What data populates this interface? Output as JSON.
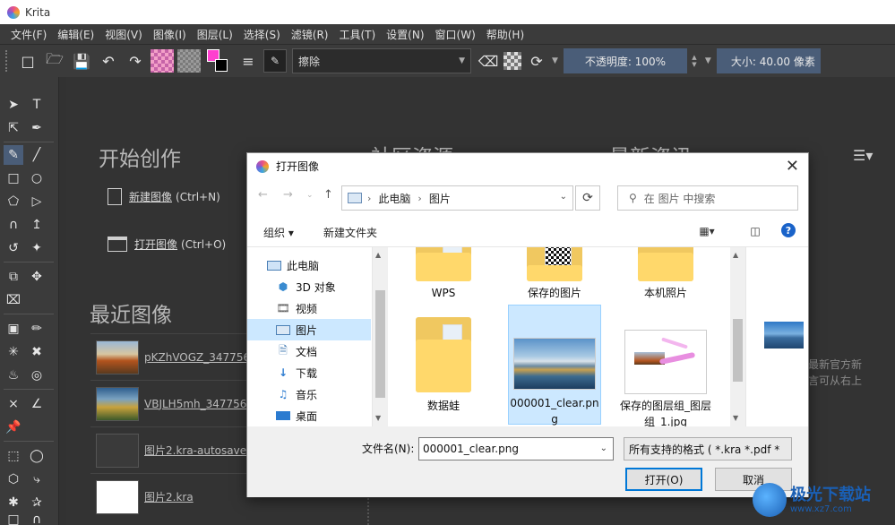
{
  "window": {
    "title": "Krita"
  },
  "menu": [
    "文件(F)",
    "编辑(E)",
    "视图(V)",
    "图像(I)",
    "图层(L)",
    "选择(S)",
    "滤镜(R)",
    "工具(T)",
    "设置(N)",
    "窗口(W)",
    "帮助(H)"
  ],
  "toolbar": {
    "blend_mode": "擦除",
    "opacity": "不透明度: 100%",
    "size": "大小: 40.00 像素",
    "colors": {
      "foreground": "#ff3fcf",
      "background": "#000000",
      "accent": "#4a5d78"
    }
  },
  "welcome": {
    "start_title": "开始创作",
    "new_image": "新建图像",
    "new_image_shortcut": "(Ctrl+N)",
    "open_image": "打开图像",
    "open_image_shortcut": "(Ctrl+O)",
    "recent_title": "最近图像",
    "community_title": "社区资源",
    "news_title": "最新资讯",
    "recent_files": [
      {
        "name": "pKZhVOGZ_347756..."
      },
      {
        "name": "VBJLH5mh_3477564"
      },
      {
        "name": "图片2.kra-autosave..."
      },
      {
        "name": "图片2.kra"
      }
    ],
    "news_text_1": "最新官方新",
    "news_text_2": "言可从右上"
  },
  "dialog": {
    "title": "打开图像",
    "path": [
      "此电脑",
      "图片"
    ],
    "search_placeholder": "在 图片 中搜索",
    "organize": "组织 ▾",
    "new_folder": "新建文件夹",
    "help": "?",
    "nav": [
      {
        "label": "此电脑",
        "icon": "computer-icon"
      },
      {
        "label": "3D 对象",
        "icon": "cube-icon"
      },
      {
        "label": "视频",
        "icon": "video-icon"
      },
      {
        "label": "图片",
        "icon": "picture-icon",
        "selected": true
      },
      {
        "label": "文档",
        "icon": "document-icon"
      },
      {
        "label": "下载",
        "icon": "download-icon"
      },
      {
        "label": "音乐",
        "icon": "music-icon"
      },
      {
        "label": "桌面",
        "icon": "desktop-icon"
      }
    ],
    "files": [
      {
        "label": "WPS",
        "kind": "folder"
      },
      {
        "label": "保存的图片",
        "kind": "folder"
      },
      {
        "label": "本机照片",
        "kind": "folder"
      },
      {
        "label": "数据蛙",
        "kind": "folder"
      },
      {
        "label": "000001_clear.png",
        "kind": "image",
        "selected": true
      },
      {
        "label": "保存的图层组_图层组_1.jpg",
        "kind": "image"
      }
    ],
    "filename_label": "文件名(N):",
    "filename_value": "000001_clear.png",
    "filetype": "所有支持的格式 ( *.kra *.pdf *",
    "open_button": "打开(O)",
    "cancel_button": "取消"
  },
  "watermark": {
    "text": "极光下载站",
    "url": "www.xz7.com"
  }
}
